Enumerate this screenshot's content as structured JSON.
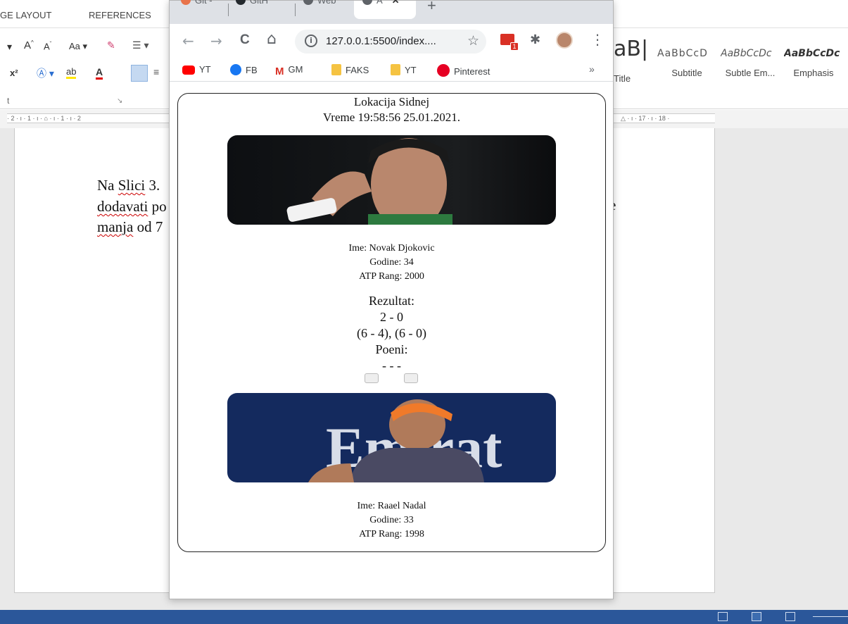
{
  "word": {
    "ribbon_tabs": [
      "GE LAYOUT",
      "REFERENCES"
    ],
    "styles": [
      {
        "sample": "aB|",
        "name": "Title"
      },
      {
        "sample": "AaBbCcD",
        "name": "Subtitle"
      },
      {
        "sample": "AaBbCcDc",
        "name": "Subtle Em..."
      },
      {
        "sample": "AaBbCcDc",
        "name": "Emphasis"
      }
    ],
    "ruler_left": "· 2 · ı · 1 · ı · ⌂ · ı · 1 · ı · 2",
    "ruler_right": "△ · ı · 17 · ı · 18 ·",
    "paragraph": {
      "line1_plain": "Na ",
      "line1_err": "Slici",
      "line1_tail": " 3.",
      "line2_err": "dodavati",
      "line2_tail": " po",
      "line3_err": "manja",
      "line3_tail": " od 7",
      "right_fragment": "e"
    }
  },
  "chrome": {
    "tabs": [
      {
        "label": "Git -",
        "color": "#e8734a"
      },
      {
        "label": "GitH",
        "color": "#24292e"
      },
      {
        "label": "Web",
        "color": "#5f6368"
      },
      {
        "label": "A",
        "color": "#5f6368"
      }
    ],
    "close_glyph": "✕",
    "new_tab_glyph": "+",
    "url": "127.0.0.1:5500/index....",
    "info_glyph": "i",
    "star_glyph": "☆",
    "back_glyph": "←",
    "forward_glyph": "→",
    "reload_glyph": "C",
    "home_glyph": "⌂",
    "menu_glyph": "⋮",
    "ext_badge": "1",
    "more_glyph": "»",
    "bookmarks": [
      {
        "label": "YT",
        "icon": "youtube-icon",
        "color": "#ff0000"
      },
      {
        "label": "FB",
        "icon": "facebook-icon",
        "color": "#1877f2"
      },
      {
        "label": "GM",
        "icon": "gmail-icon",
        "color": "#d93025"
      },
      {
        "label": "FAKS",
        "icon": "folder-icon",
        "color": "#f5c342"
      },
      {
        "label": "YT",
        "icon": "folder-icon",
        "color": "#f5c342"
      },
      {
        "label": "Pinterest",
        "icon": "pinterest-icon",
        "color": "#e60023"
      }
    ]
  },
  "page": {
    "location": "Lokacija Sidnej",
    "time": "Vreme 19:58:56 25.01.2021.",
    "player1": {
      "name": "Ime: Novak Djokovic",
      "age": "Godine: 34",
      "rank": "ATP Rang: 2000"
    },
    "result_label": "Rezultat:",
    "result": "2 - 0",
    "sets": "(6 - 4), (6 - 0)",
    "points_label": "Poeni:",
    "points": "- - -",
    "player2": {
      "name": "Ime: Raael Nadal",
      "age": "Godine: 33",
      "rank": "ATP Rang: 1998"
    },
    "player2_banner_text": "Emirat"
  }
}
